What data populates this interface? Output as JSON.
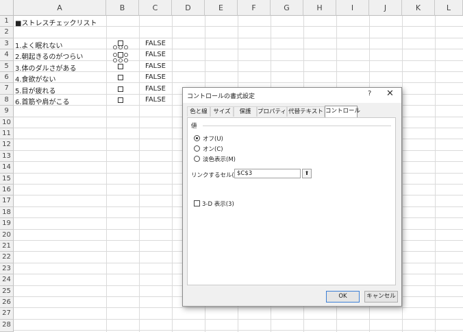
{
  "columns": [
    "A",
    "B",
    "C",
    "D",
    "E",
    "F",
    "G",
    "H",
    "I",
    "J",
    "K",
    "L"
  ],
  "rows": [
    "1",
    "2",
    "3",
    "4",
    "5",
    "6",
    "7",
    "8",
    "9",
    "10",
    "11",
    "12",
    "13",
    "14",
    "15",
    "16",
    "17",
    "18",
    "19",
    "20",
    "21",
    "22",
    "23",
    "24",
    "25",
    "26",
    "27",
    "28"
  ],
  "cells": {
    "a1": "■ストレスチェックリスト",
    "a3": "1.よく眠れない",
    "a4": "2.朝起きるのがつらい",
    "a5": "3.体のダルさがある",
    "a6": "4.食欲がない",
    "a7": "5.目が疲れる",
    "a8": "6.首筋や肩がこる",
    "c3": "FALSE",
    "c4": "FALSE",
    "c5": "FALSE",
    "c6": "FALSE",
    "c7": "FALSE",
    "c8": "FALSE"
  },
  "dialog": {
    "title": "コントロールの書式設定",
    "help": "?",
    "close": "✕",
    "tabs": [
      "色と線",
      "サイズ",
      "保護",
      "プロパティ",
      "代替テキスト",
      "コントロール"
    ],
    "active_tab": "コントロール",
    "value_group": "値",
    "radio_off": "オフ(U)",
    "radio_on": "オン(C)",
    "radio_mixed": "淡色表示(M)",
    "selected_radio": "オフ(U)",
    "link_label": "リンクするセル(L):",
    "link_value": "$C$3",
    "ref_icon": "⬆",
    "shading_3d": "3-D 表示(3)",
    "shading_3d_checked": false,
    "ok": "OK",
    "cancel": "キャンセル"
  }
}
